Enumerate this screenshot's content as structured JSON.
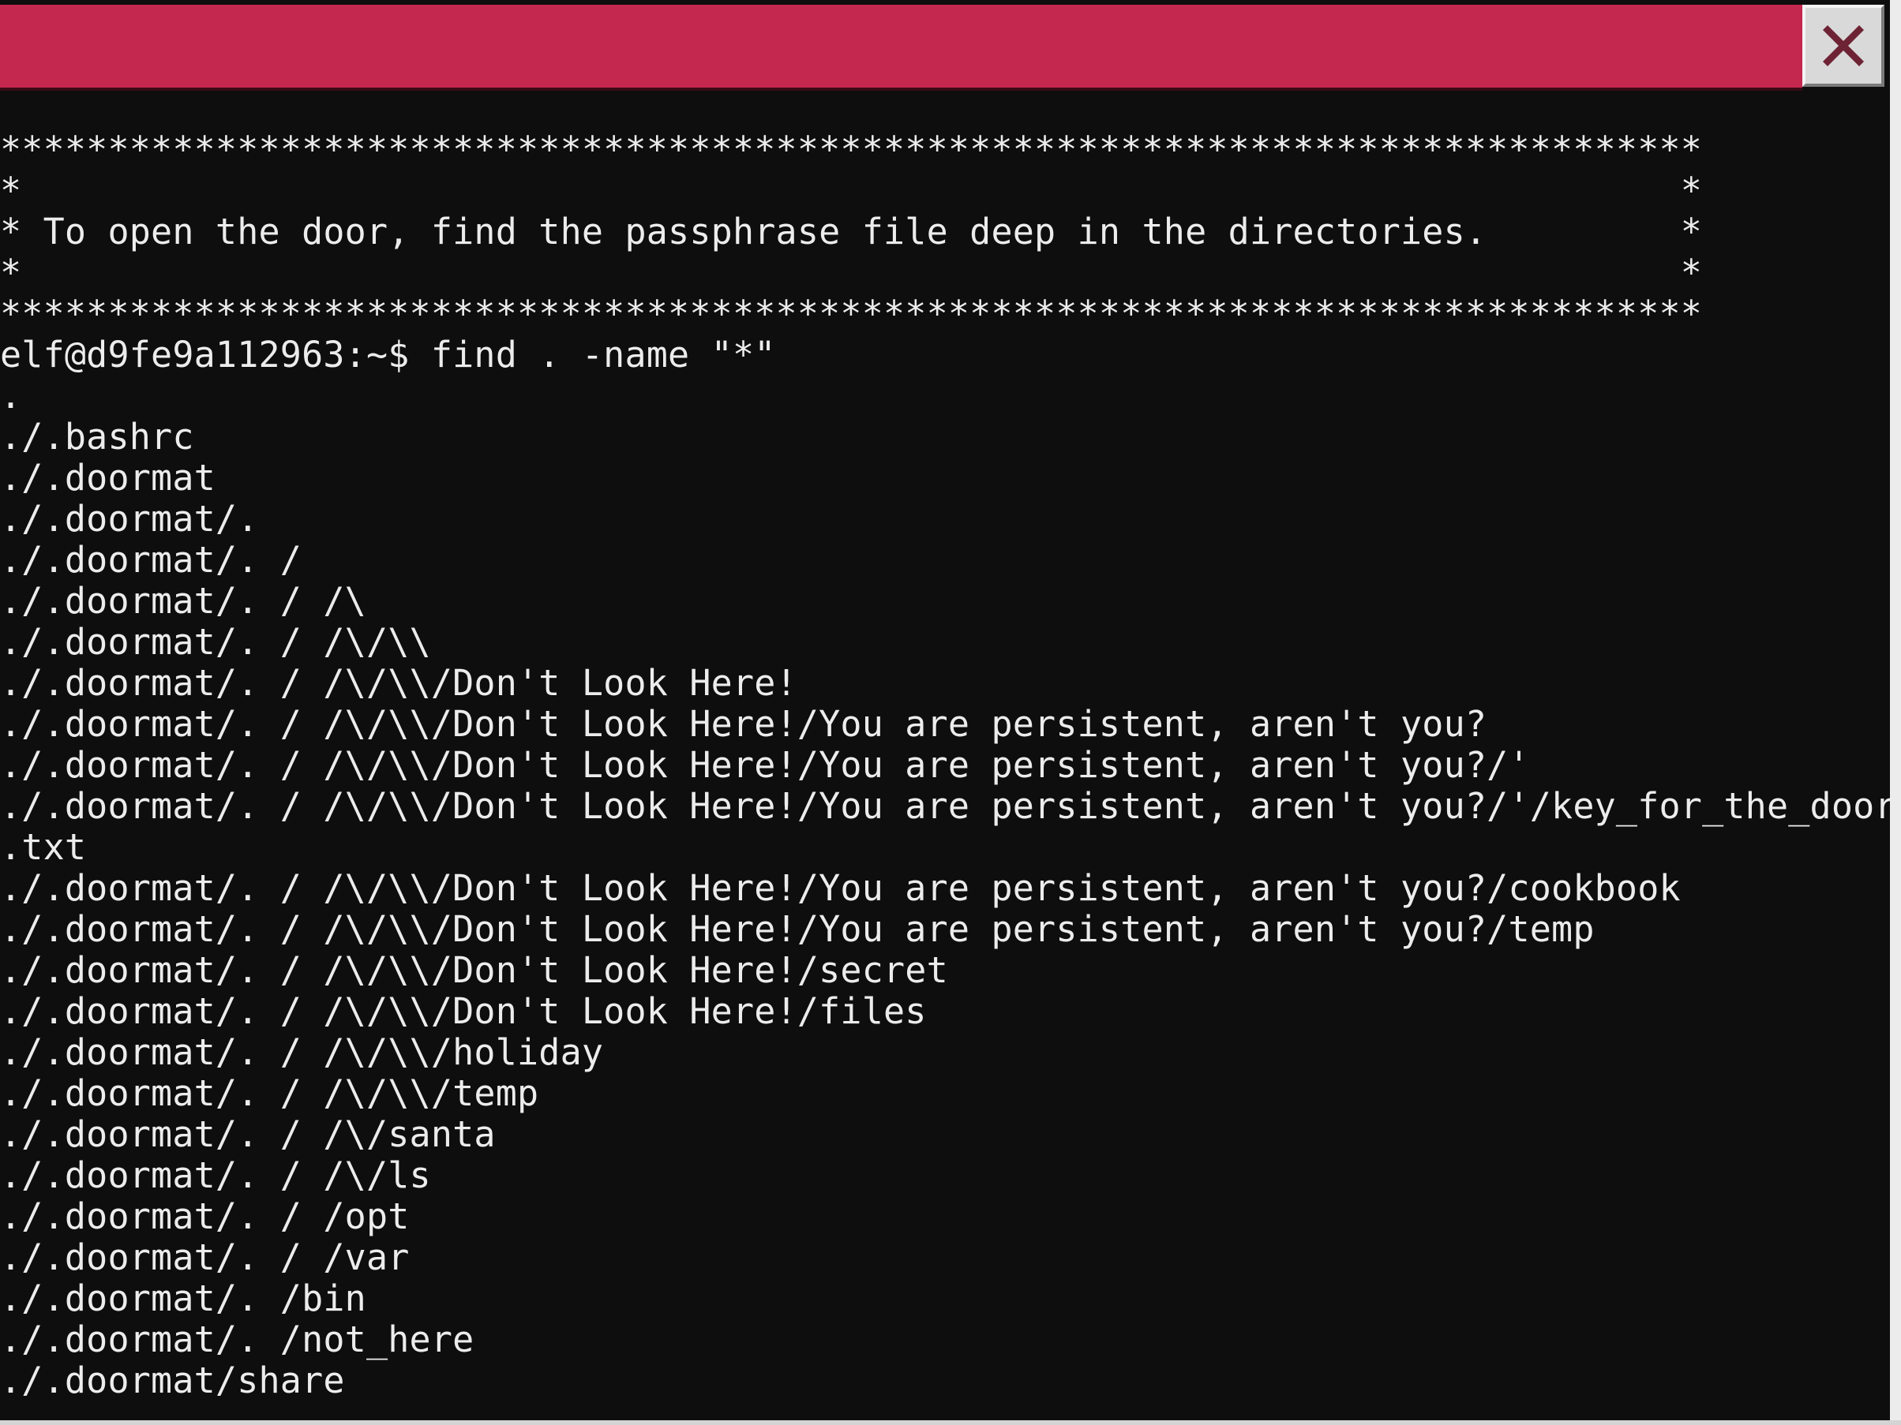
{
  "window": {
    "close_icon": "close-x-icon",
    "colors": {
      "titlebar": "#c4284f",
      "background": "#0e0e0e",
      "text": "#ececec",
      "close_x": "#6e2335"
    }
  },
  "terminal": {
    "lines": [
      "*******************************************************************************",
      "*                                                                             *",
      "* To open the door, find the passphrase file deep in the directories.         *",
      "*                                                                             *",
      "*******************************************************************************",
      "elf@d9fe9a112963:~$ find . -name \"*\"",
      ".",
      "./.bashrc",
      "./.doormat",
      "./.doormat/.",
      "./.doormat/. /",
      "./.doormat/. / /\\",
      "./.doormat/. / /\\/\\\\",
      "./.doormat/. / /\\/\\\\/Don't Look Here!",
      "./.doormat/. / /\\/\\\\/Don't Look Here!/You are persistent, aren't you?",
      "./.doormat/. / /\\/\\\\/Don't Look Here!/You are persistent, aren't you?/'",
      "./.doormat/. / /\\/\\\\/Don't Look Here!/You are persistent, aren't you?/'/key_for_the_door",
      ".txt",
      "./.doormat/. / /\\/\\\\/Don't Look Here!/You are persistent, aren't you?/cookbook",
      "./.doormat/. / /\\/\\\\/Don't Look Here!/You are persistent, aren't you?/temp",
      "./.doormat/. / /\\/\\\\/Don't Look Here!/secret",
      "./.doormat/. / /\\/\\\\/Don't Look Here!/files",
      "./.doormat/. / /\\/\\\\/holiday",
      "./.doormat/. / /\\/\\\\/temp",
      "./.doormat/. / /\\/santa",
      "./.doormat/. / /\\/ls",
      "./.doormat/. / /opt",
      "./.doormat/. / /var",
      "./.doormat/. /bin",
      "./.doormat/. /not_here",
      "./.doormat/share"
    ]
  }
}
